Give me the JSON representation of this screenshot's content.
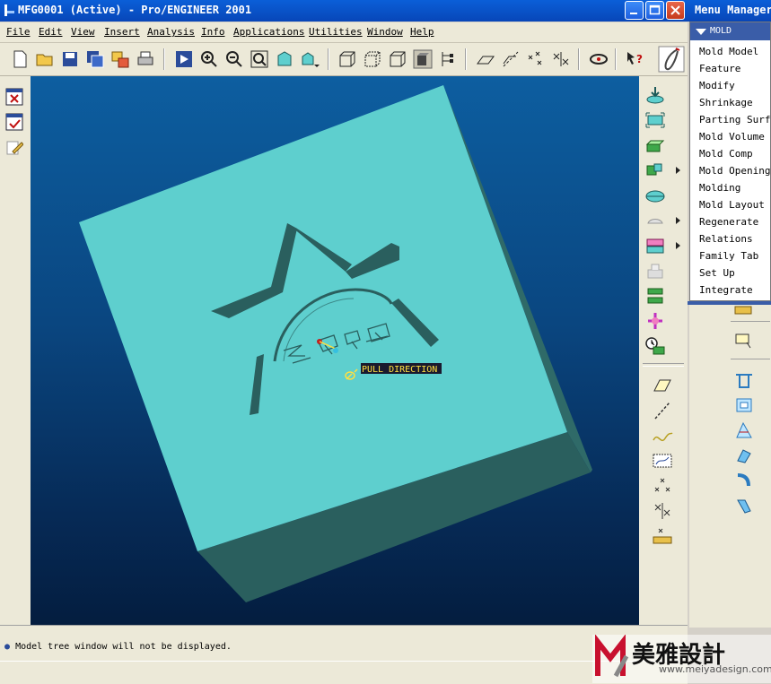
{
  "window": {
    "title": "MFG0001 (Active) - Pro/ENGINEER 2001"
  },
  "menubar": {
    "items": [
      "File",
      "Edit",
      "View",
      "Insert",
      "Analysis",
      "Info",
      "Applications",
      "Utilities",
      "Window",
      "Help"
    ]
  },
  "viewport": {
    "model_color": "#5ecfce",
    "side_color": "#2a5f5e",
    "label_pull_direction": "PULL DIRECTION"
  },
  "message_area": {
    "message": "Model tree window will not be displayed."
  },
  "menu_manager": {
    "title": "Menu Manager",
    "section": "MOLD",
    "items": [
      "Mold Model",
      "Feature",
      "Modify",
      "Shrinkage",
      "Parting Surf",
      "Mold Volume",
      "Mold Comp",
      "Mold Opening",
      "Molding",
      "Mold Layout",
      "Regenerate",
      "Relations",
      "Family Tab",
      "Set Up",
      "Integrate"
    ]
  },
  "watermark": {
    "brand": "美雅設計",
    "url": "www.meiyadesign.com"
  },
  "colors": {
    "titlebar": "#0a5fd8",
    "accent": "#3a5da8"
  }
}
